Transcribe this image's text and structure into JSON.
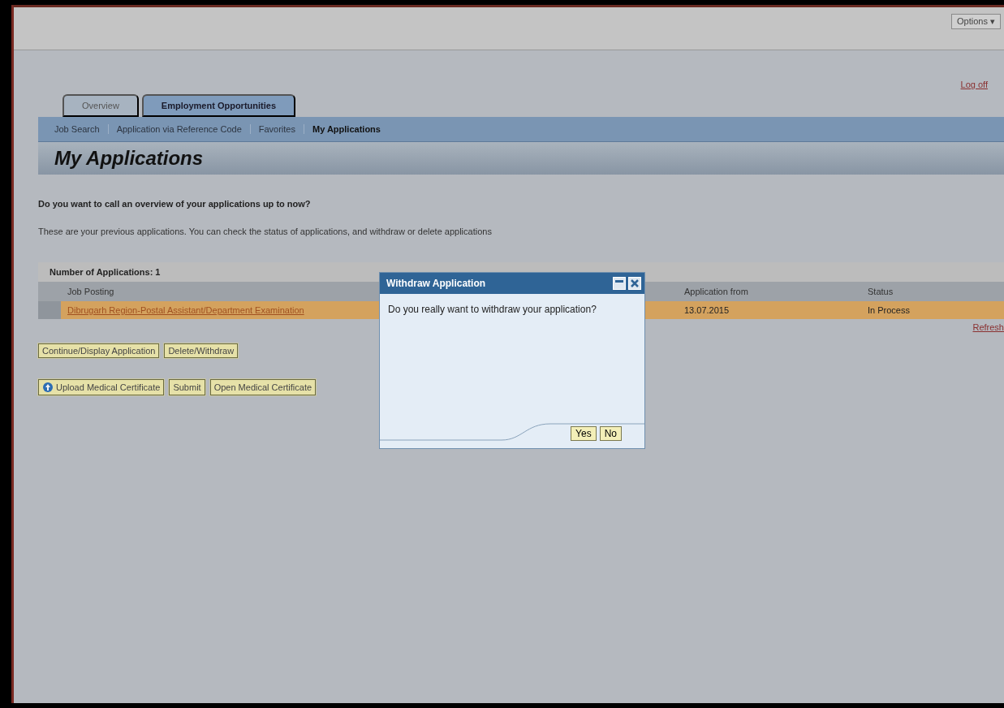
{
  "options_menu": {
    "label": "Options ▾"
  },
  "logoff": "Log off",
  "tabs": [
    {
      "label": "Overview",
      "selected": false
    },
    {
      "label": "Employment Opportunities",
      "selected": true
    }
  ],
  "subnav": [
    {
      "label": "Job Search",
      "selected": false
    },
    {
      "label": "Application via Reference Code",
      "selected": false
    },
    {
      "label": "Favorites",
      "selected": false
    },
    {
      "label": "My Applications",
      "selected": true
    }
  ],
  "page_title": "My Applications",
  "question": "Do you want to call an overview of your applications up to now?",
  "intro": "These are your previous applications. You can check the status of applications, and withdraw or delete applications",
  "table": {
    "caption": "Number of Applications: 1",
    "columns": [
      "Job Posting",
      "Application from",
      "Status"
    ],
    "rows": [
      {
        "job_posting": "Dibrugarh Region-Postal Assistant/Department Examination",
        "application_from": "13.07.2015",
        "status": "In Process",
        "selected": true
      }
    ]
  },
  "refresh": "Refresh",
  "buttons_row1": [
    "Continue/Display Application",
    "Delete/Withdraw"
  ],
  "buttons_row2": [
    {
      "label": "Upload Medical Certificate",
      "kind": "icon"
    },
    {
      "label": "Submit",
      "kind": "plain"
    },
    {
      "label": "Open Medical Certificate",
      "kind": "plain"
    }
  ],
  "dialog": {
    "title": "Withdraw Application",
    "message": "Do you really want to withdraw your application?",
    "buttons": [
      "Yes",
      "No"
    ]
  }
}
